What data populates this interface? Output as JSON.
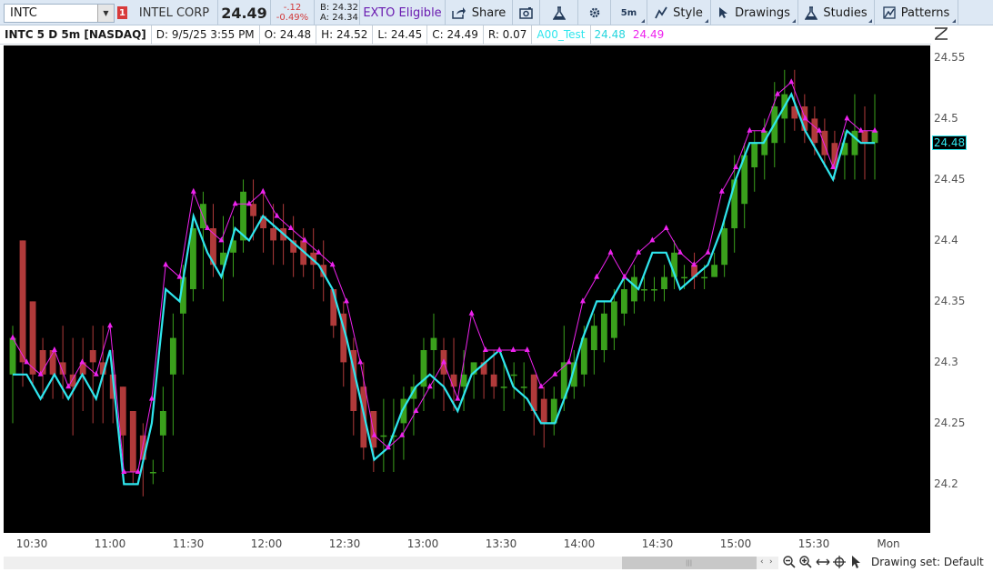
{
  "toolbar": {
    "symbol": "INTC",
    "alert_count": "1",
    "company": "INTEL CORP",
    "last": "24.49",
    "change": "-.12",
    "change_pct": "-0.49%",
    "bid": "B: 24.32",
    "ask": "A: 24.34",
    "exto": "EXTO Eligible",
    "share": "Share",
    "interval": "5m",
    "style": "Style",
    "drawings": "Drawings",
    "studies": "Studies",
    "patterns": "Patterns"
  },
  "infobar": {
    "title": "INTC 5 D 5m [NASDAQ]",
    "date": "D: 9/5/25 3:55 PM",
    "open": "O: 24.48",
    "high": "H: 24.52",
    "low": "L: 24.45",
    "close": "C: 24.49",
    "range": "R: 0.07",
    "study_name": "A00_Test",
    "study_val1": "24.48",
    "study_val2": "24.49"
  },
  "price_axis": {
    "labels": [
      "24.55",
      "24.5",
      "24.45",
      "24.4",
      "24.35",
      "24.3",
      "24.25",
      "24.2"
    ],
    "current": "24.48"
  },
  "time_axis": {
    "labels": [
      "10:30",
      "11:00",
      "11:30",
      "12:00",
      "12:30",
      "13:00",
      "13:30",
      "14:00",
      "14:30",
      "15:00",
      "15:30",
      "Mon"
    ]
  },
  "bottom": {
    "drawing_set": "Drawing set: Default"
  },
  "colors": {
    "up": "#3aa01c",
    "down": "#b03a3a",
    "wick_up": "#3aa01c",
    "wick_down": "#b03a3a",
    "study_line": "#2fe6ee",
    "study_line2": "#ee22ee",
    "background": "#000000"
  },
  "chart_data": {
    "type": "candlestick",
    "symbol": "INTC",
    "interval": "5m",
    "ylim": [
      24.16,
      24.56
    ],
    "candles": [
      {
        "o": 24.29,
        "h": 24.33,
        "l": 24.25,
        "c": 24.32
      },
      {
        "o": 24.4,
        "h": 24.4,
        "l": 24.28,
        "c": 24.3
      },
      {
        "o": 24.35,
        "h": 24.35,
        "l": 24.28,
        "c": 24.29
      },
      {
        "o": 24.31,
        "h": 24.32,
        "l": 24.27,
        "c": 24.29
      },
      {
        "o": 24.31,
        "h": 24.31,
        "l": 24.27,
        "c": 24.29
      },
      {
        "o": 24.3,
        "h": 24.33,
        "l": 24.27,
        "c": 24.29
      },
      {
        "o": 24.29,
        "h": 24.32,
        "l": 24.24,
        "c": 24.28
      },
      {
        "o": 24.3,
        "h": 24.32,
        "l": 24.26,
        "c": 24.29
      },
      {
        "o": 24.31,
        "h": 24.33,
        "l": 24.25,
        "c": 24.3
      },
      {
        "o": 24.3,
        "h": 24.33,
        "l": 24.25,
        "c": 24.29
      },
      {
        "o": 24.29,
        "h": 24.31,
        "l": 24.25,
        "c": 24.27
      },
      {
        "o": 24.28,
        "h": 24.28,
        "l": 24.22,
        "c": 24.24
      },
      {
        "o": 24.26,
        "h": 24.26,
        "l": 24.2,
        "c": 24.21
      },
      {
        "o": 24.24,
        "h": 24.25,
        "l": 24.19,
        "c": 24.22
      },
      {
        "o": 24.21,
        "h": 24.22,
        "l": 24.2,
        "c": 24.21
      },
      {
        "o": 24.24,
        "h": 24.28,
        "l": 24.21,
        "c": 24.26
      },
      {
        "o": 24.29,
        "h": 24.34,
        "l": 24.24,
        "c": 24.32
      },
      {
        "o": 24.34,
        "h": 24.38,
        "l": 24.29,
        "c": 24.37
      },
      {
        "o": 24.36,
        "h": 24.42,
        "l": 24.35,
        "c": 24.41
      },
      {
        "o": 24.41,
        "h": 24.44,
        "l": 24.36,
        "c": 24.43
      },
      {
        "o": 24.41,
        "h": 24.43,
        "l": 24.37,
        "c": 24.38
      },
      {
        "o": 24.38,
        "h": 24.42,
        "l": 24.35,
        "c": 24.39
      },
      {
        "o": 24.39,
        "h": 24.42,
        "l": 24.37,
        "c": 24.4
      },
      {
        "o": 24.4,
        "h": 24.45,
        "l": 24.39,
        "c": 24.44
      },
      {
        "o": 24.43,
        "h": 24.45,
        "l": 24.4,
        "c": 24.42
      },
      {
        "o": 24.42,
        "h": 24.44,
        "l": 24.39,
        "c": 24.41
      },
      {
        "o": 24.41,
        "h": 24.43,
        "l": 24.38,
        "c": 24.4
      },
      {
        "o": 24.41,
        "h": 24.43,
        "l": 24.38,
        "c": 24.4
      },
      {
        "o": 24.4,
        "h": 24.42,
        "l": 24.37,
        "c": 24.39
      },
      {
        "o": 24.4,
        "h": 24.41,
        "l": 24.37,
        "c": 24.38
      },
      {
        "o": 24.39,
        "h": 24.41,
        "l": 24.36,
        "c": 24.38
      },
      {
        "o": 24.38,
        "h": 24.4,
        "l": 24.35,
        "c": 24.37
      },
      {
        "o": 24.36,
        "h": 24.36,
        "l": 24.32,
        "c": 24.33
      },
      {
        "o": 24.34,
        "h": 24.35,
        "l": 24.28,
        "c": 24.3
      },
      {
        "o": 24.31,
        "h": 24.32,
        "l": 24.24,
        "c": 24.26
      },
      {
        "o": 24.28,
        "h": 24.3,
        "l": 24.22,
        "c": 24.23
      },
      {
        "o": 24.26,
        "h": 24.26,
        "l": 24.21,
        "c": 24.23
      },
      {
        "o": 24.24,
        "h": 24.27,
        "l": 24.21,
        "c": 24.24
      },
      {
        "o": 24.24,
        "h": 24.27,
        "l": 24.21,
        "c": 24.24
      },
      {
        "o": 24.25,
        "h": 24.28,
        "l": 24.22,
        "c": 24.27
      },
      {
        "o": 24.27,
        "h": 24.29,
        "l": 24.24,
        "c": 24.28
      },
      {
        "o": 24.28,
        "h": 24.32,
        "l": 24.26,
        "c": 24.31
      },
      {
        "o": 24.31,
        "h": 24.34,
        "l": 24.27,
        "c": 24.32
      },
      {
        "o": 24.31,
        "h": 24.32,
        "l": 24.26,
        "c": 24.29
      },
      {
        "o": 24.29,
        "h": 24.32,
        "l": 24.26,
        "c": 24.28
      },
      {
        "o": 24.28,
        "h": 24.31,
        "l": 24.26,
        "c": 24.29
      },
      {
        "o": 24.29,
        "h": 24.3,
        "l": 24.27,
        "c": 24.3
      },
      {
        "o": 24.3,
        "h": 24.31,
        "l": 24.27,
        "c": 24.29
      },
      {
        "o": 24.29,
        "h": 24.31,
        "l": 24.27,
        "c": 24.28
      },
      {
        "o": 24.28,
        "h": 24.3,
        "l": 24.26,
        "c": 24.28
      },
      {
        "o": 24.29,
        "h": 24.3,
        "l": 24.27,
        "c": 24.29
      },
      {
        "o": 24.28,
        "h": 24.3,
        "l": 24.26,
        "c": 24.28
      },
      {
        "o": 24.29,
        "h": 24.29,
        "l": 24.24,
        "c": 24.26
      },
      {
        "o": 24.27,
        "h": 24.28,
        "l": 24.23,
        "c": 24.25
      },
      {
        "o": 24.25,
        "h": 24.28,
        "l": 24.24,
        "c": 24.27
      },
      {
        "o": 24.27,
        "h": 24.33,
        "l": 24.26,
        "c": 24.3
      },
      {
        "o": 24.28,
        "h": 24.31,
        "l": 24.27,
        "c": 24.3
      },
      {
        "o": 24.29,
        "h": 24.33,
        "l": 24.28,
        "c": 24.32
      },
      {
        "o": 24.31,
        "h": 24.34,
        "l": 24.29,
        "c": 24.33
      },
      {
        "o": 24.31,
        "h": 24.35,
        "l": 24.3,
        "c": 24.34
      },
      {
        "o": 24.32,
        "h": 24.36,
        "l": 24.31,
        "c": 24.35
      },
      {
        "o": 24.34,
        "h": 24.37,
        "l": 24.33,
        "c": 24.36
      },
      {
        "o": 24.35,
        "h": 24.38,
        "l": 24.34,
        "c": 24.37
      },
      {
        "o": 24.36,
        "h": 24.37,
        "l": 24.35,
        "c": 24.36
      },
      {
        "o": 24.36,
        "h": 24.37,
        "l": 24.35,
        "c": 24.36
      },
      {
        "o": 24.36,
        "h": 24.38,
        "l": 24.35,
        "c": 24.37
      },
      {
        "o": 24.37,
        "h": 24.4,
        "l": 24.36,
        "c": 24.39
      },
      {
        "o": 24.37,
        "h": 24.38,
        "l": 24.36,
        "c": 24.37
      },
      {
        "o": 24.38,
        "h": 24.39,
        "l": 24.36,
        "c": 24.37
      },
      {
        "o": 24.37,
        "h": 24.38,
        "l": 24.36,
        "c": 24.37
      },
      {
        "o": 24.37,
        "h": 24.39,
        "l": 24.37,
        "c": 24.38
      },
      {
        "o": 24.38,
        "h": 24.42,
        "l": 24.37,
        "c": 24.41
      },
      {
        "o": 24.41,
        "h": 24.47,
        "l": 24.39,
        "c": 24.45
      },
      {
        "o": 24.43,
        "h": 24.48,
        "l": 24.41,
        "c": 24.47
      },
      {
        "o": 24.46,
        "h": 24.49,
        "l": 24.44,
        "c": 24.48
      },
      {
        "o": 24.47,
        "h": 24.5,
        "l": 24.45,
        "c": 24.49
      },
      {
        "o": 24.48,
        "h": 24.53,
        "l": 24.46,
        "c": 24.51
      },
      {
        "o": 24.5,
        "h": 24.54,
        "l": 24.48,
        "c": 24.52
      },
      {
        "o": 24.51,
        "h": 24.54,
        "l": 24.49,
        "c": 24.5
      },
      {
        "o": 24.51,
        "h": 24.52,
        "l": 24.48,
        "c": 24.49
      },
      {
        "o": 24.5,
        "h": 24.51,
        "l": 24.47,
        "c": 24.48
      },
      {
        "o": 24.49,
        "h": 24.5,
        "l": 24.46,
        "c": 24.47
      },
      {
        "o": 24.48,
        "h": 24.49,
        "l": 24.45,
        "c": 24.46
      },
      {
        "o": 24.47,
        "h": 24.49,
        "l": 24.45,
        "c": 24.48
      },
      {
        "o": 24.47,
        "h": 24.52,
        "l": 24.45,
        "c": 24.49
      },
      {
        "o": 24.49,
        "h": 24.51,
        "l": 24.45,
        "c": 24.48
      },
      {
        "o": 24.48,
        "h": 24.52,
        "l": 24.45,
        "c": 24.49
      }
    ],
    "study_a00_test": [
      24.29,
      24.29,
      24.27,
      24.29,
      24.27,
      24.29,
      24.27,
      24.31,
      24.2,
      24.2,
      24.25,
      24.36,
      24.35,
      24.42,
      24.39,
      24.37,
      24.41,
      24.4,
      24.42,
      24.41,
      24.4,
      24.39,
      24.38,
      24.36,
      24.32,
      24.27,
      24.22,
      24.23,
      24.26,
      24.28,
      24.29,
      24.28,
      24.26,
      24.29,
      24.3,
      24.31,
      24.28,
      24.27,
      24.25,
      24.25,
      24.28,
      24.32,
      24.35,
      24.35,
      24.37,
      24.36,
      24.39,
      24.39,
      24.36,
      24.37,
      24.38,
      24.41,
      24.45,
      24.48,
      24.48,
      24.5,
      24.52,
      24.49,
      24.47,
      24.45,
      24.49,
      24.48,
      24.48
    ],
    "study_high_markers": [
      24.32,
      24.3,
      24.29,
      24.31,
      24.28,
      24.3,
      24.29,
      24.33,
      24.21,
      24.21,
      24.27,
      24.38,
      24.37,
      24.44,
      24.41,
      24.4,
      24.43,
      24.43,
      24.44,
      24.42,
      24.41,
      24.4,
      24.39,
      24.38,
      24.35,
      24.3,
      24.24,
      24.23,
      24.24,
      24.26,
      24.28,
      24.3,
      24.27,
      24.34,
      24.31,
      24.31,
      24.31,
      24.31,
      24.28,
      24.29,
      24.3,
      24.35,
      24.37,
      24.39,
      24.37,
      24.39,
      24.4,
      24.41,
      24.39,
      24.38,
      24.39,
      24.44,
      24.46,
      24.49,
      24.49,
      24.52,
      24.53,
      24.5,
      24.49,
      24.46,
      24.5,
      24.49,
      24.49
    ]
  }
}
